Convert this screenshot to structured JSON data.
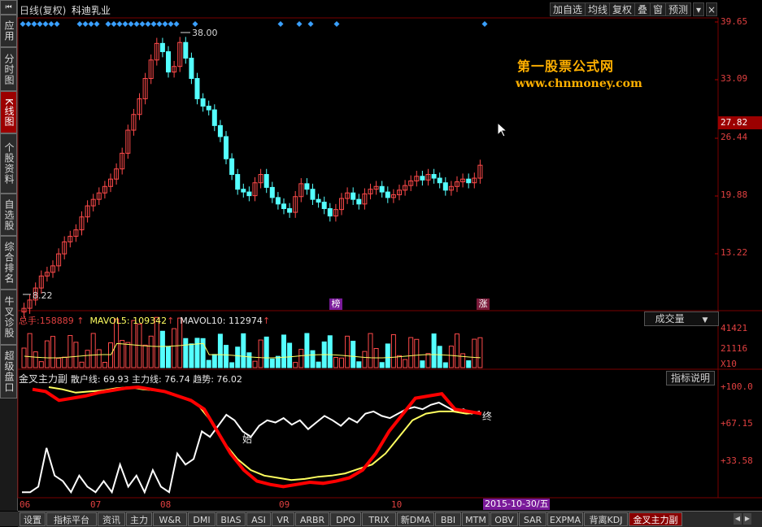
{
  "title_bar": {
    "period": "日线(复权)",
    "stock_name": "科迪乳业"
  },
  "toolbar": [
    "加自选",
    "均线",
    "复权",
    "叠",
    "窗",
    "预测"
  ],
  "left_tabs": [
    {
      "label": "应用",
      "active": false
    },
    {
      "label": "分时图",
      "active": false
    },
    {
      "label": "K线图",
      "active": true
    },
    {
      "label": "个股资料",
      "active": false
    },
    {
      "label": "自选股",
      "active": false
    },
    {
      "label": "综合排名",
      "active": false
    },
    {
      "label": "牛叉诊股",
      "active": false
    },
    {
      "label": "超级盘口",
      "active": false
    }
  ],
  "price_axis": [
    "39.65",
    "33.09",
    "26.44",
    "19.88",
    "13.22"
  ],
  "current_price": "27.82",
  "high_label": "38.00",
  "low_label": "8.22",
  "watermark": {
    "line1": "第一股票公式网",
    "line2": "www.chnmoney.com"
  },
  "markers": {
    "bang": "榜",
    "zhang": "涨"
  },
  "volume_panel": {
    "total_label": "总手:",
    "total_value": "158889",
    "ma5_label": "MAVOL5:",
    "ma5_value": "109342",
    "ma10_label": "MAVOL10:",
    "ma10_value": "112974",
    "selector": "成交量",
    "axis": [
      "41421",
      "21116",
      "X10"
    ]
  },
  "indicator_panel": {
    "name": "金叉主力副",
    "params": "散户线: 69.93  主力线: 76.74  趋势: 76.02",
    "help_button": "指标说明",
    "axis": [
      "+100.0",
      "+67.15",
      "+33.58"
    ],
    "start_marker": "始",
    "end_marker": "终"
  },
  "date_axis": [
    "06",
    "07",
    "08",
    "09",
    "10"
  ],
  "cursor_date": "2015-10-30/五",
  "bottom_tabs": [
    "设置",
    "指标平台",
    "资讯",
    "主力",
    "W&R",
    "DMI",
    "BIAS",
    "ASI",
    "VR",
    "ARBR",
    "DPO",
    "TRIX",
    "新DMA",
    "BBI",
    "MTM",
    "OBV",
    "SAR",
    "EXPMA",
    "背离KDJ",
    "金叉主力副"
  ],
  "active_bottom_tab": "金叉主力副",
  "colors": {
    "up": "#ff4a4a",
    "down": "#54ffff",
    "main_line": "#ff0000",
    "trend_line": "#ffff60",
    "retail_line": "#ffffff",
    "axis_text": "#e04040",
    "marker": "#3aa0ff"
  }
}
